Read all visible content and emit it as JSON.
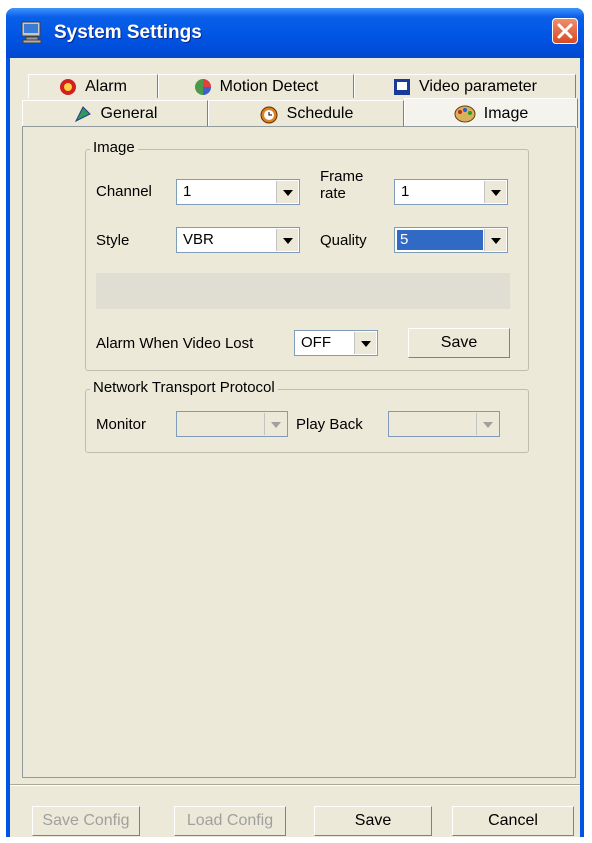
{
  "window": {
    "title": "System Settings",
    "close_icon": "close-icon"
  },
  "tabs": {
    "row1": [
      {
        "label": "Alarm",
        "icon": "alarm-icon"
      },
      {
        "label": "Motion Detect",
        "icon": "motion-detect-icon"
      },
      {
        "label": "Video parameter",
        "icon": "video-parameter-icon"
      }
    ],
    "row2": [
      {
        "label": "General",
        "icon": "general-icon"
      },
      {
        "label": "Schedule",
        "icon": "schedule-icon"
      },
      {
        "label": "Image",
        "icon": "image-icon",
        "active": true
      }
    ]
  },
  "image_group": {
    "legend": "Image",
    "channel_label": "Channel",
    "channel_value": "1",
    "frame_rate_label1": "Frame",
    "frame_rate_label2": "rate",
    "frame_rate_value": "1",
    "style_label": "Style",
    "style_value": "VBR",
    "quality_label": "Quality",
    "quality_value": "5",
    "alarm_lost_label": "Alarm When Video Lost",
    "alarm_lost_value": "OFF",
    "save_label": "Save"
  },
  "network_group": {
    "legend": "Network Transport Protocol",
    "monitor_label": "Monitor",
    "monitor_value": "",
    "playback_label": "Play Back",
    "playback_value": ""
  },
  "footer": {
    "save_config": "Save Config",
    "load_config": "Load Config",
    "save": "Save",
    "cancel": "Cancel"
  },
  "colors": {
    "title_bar": "#0055e5",
    "selection": "#316ac5",
    "dialog_bg": "#ece9d8"
  }
}
